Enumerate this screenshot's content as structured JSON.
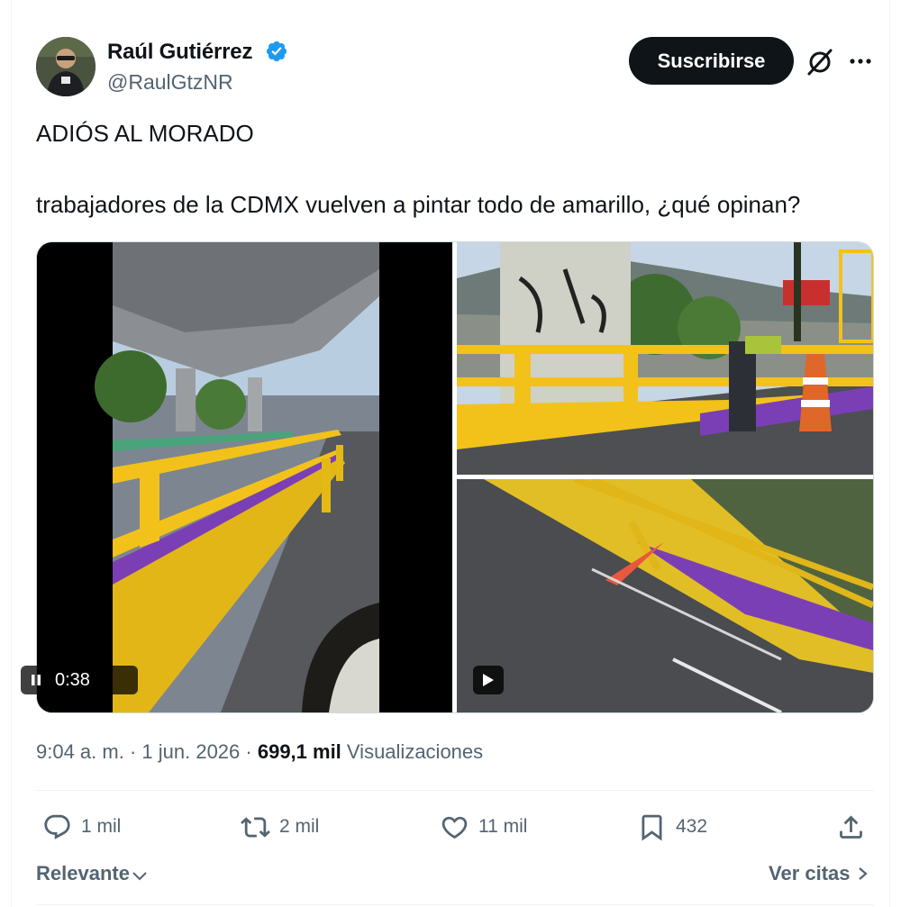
{
  "author": {
    "name": "Raúl Gutiérrez",
    "handle": "@RaulGtzNR",
    "verified": true
  },
  "header_actions": {
    "subscribe_label": "Suscribirse",
    "grok_icon": "grok-icon",
    "more_icon": "more-icon"
  },
  "tweet": {
    "title": "ADIÓS AL MORADO",
    "body": "trabajadores de la CDMX vuelven a pintar todo de amarillo, ¿qué opinan?"
  },
  "media": {
    "video_time": "0:38",
    "left_video": "video-bridge-rail",
    "right_top_video": "video-worker-painting",
    "right_bottom_video": "video-road-rail"
  },
  "meta": {
    "time": "9:04 a. m.",
    "sep1": " · ",
    "date": "1 jun. 2026",
    "sep2": " · ",
    "views_count": "699,1 mil",
    "views_label": " Visualizaciones"
  },
  "actions": {
    "replies": "1 mil",
    "retweets": "2 mil",
    "likes": "11 mil",
    "bookmarks": "432"
  },
  "footer": {
    "sort_label": "Relevante",
    "quotes_label": "Ver citas"
  },
  "colors": {
    "verified": "#1d9bf0",
    "text_primary": "#0f1419",
    "text_secondary": "#536471",
    "rail_yellow": "#f2c21a",
    "rail_purple": "#7b3fb5"
  }
}
